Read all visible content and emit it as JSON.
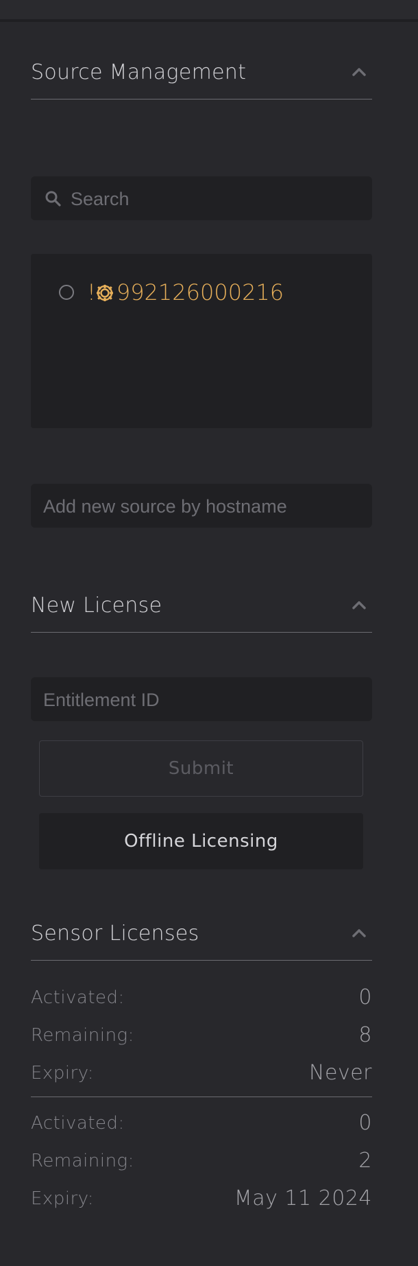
{
  "sections": {
    "source_management": {
      "title": "Source Management",
      "toggle_icon": "chevron-up-icon"
    },
    "new_license": {
      "title": "New License",
      "toggle_icon": "chevron-up-icon"
    },
    "sensor_licenses": {
      "title": "Sensor Licenses",
      "toggle_icon": "chevron-up-icon"
    }
  },
  "search": {
    "placeholder": "Search",
    "value": "",
    "icon": "search-icon"
  },
  "sources": [
    {
      "prefix": "!",
      "icon": "gear-icon",
      "name": "992126000216",
      "color": "#e8b05a",
      "selected": false
    }
  ],
  "add_source": {
    "placeholder": "Add new source by hostname",
    "value": ""
  },
  "entitlement": {
    "placeholder": "Entitlement ID",
    "value": ""
  },
  "buttons": {
    "submit": "Submit",
    "offline": "Offline Licensing"
  },
  "licenses": [
    {
      "activated_label": "Activated:",
      "activated": "0",
      "remaining_label": "Remaining:",
      "remaining": "8",
      "expiry_label": "Expiry:",
      "expiry": "Never"
    },
    {
      "activated_label": "Activated:",
      "activated": "0",
      "remaining_label": "Remaining:",
      "remaining": "2",
      "expiry_label": "Expiry:",
      "expiry": "May 11 2024"
    }
  ],
  "colors": {
    "background": "#28282c",
    "panel": "#202023",
    "accent_warning": "#e8b05a",
    "divider": "#6c6c72"
  }
}
